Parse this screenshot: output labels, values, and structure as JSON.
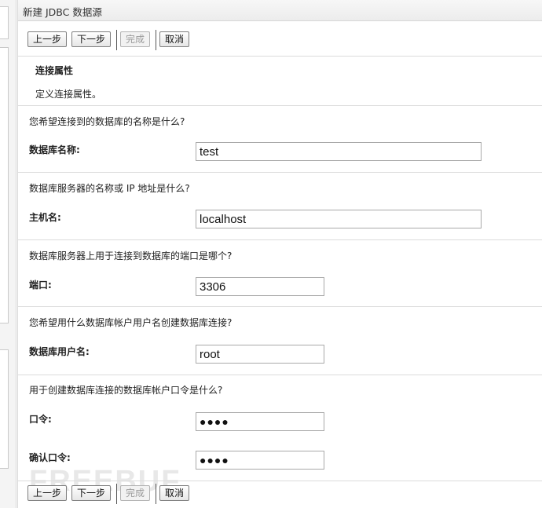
{
  "window": {
    "title": "新建 JDBC 数据源"
  },
  "buttons": {
    "back": "上一步",
    "next": "下一步",
    "finish": "完成",
    "cancel": "取消"
  },
  "section": {
    "title": "连接属性",
    "description": "定义连接属性。"
  },
  "fields": {
    "database_name": {
      "question": "您希望连接到的数据库的名称是什么?",
      "label": "数据库名称:",
      "value": "test"
    },
    "host_name": {
      "question": "数据库服务器的名称或 IP 地址是什么?",
      "label": "主机名:",
      "value": "localhost"
    },
    "port": {
      "question": "数据库服务器上用于连接到数据库的端口是哪个?",
      "label": "端口:",
      "value": "3306"
    },
    "db_user": {
      "question": "您希望用什么数据库帐户用户名创建数据库连接?",
      "label": "数据库用户名:",
      "value": "root"
    },
    "password": {
      "question": "用于创建数据库连接的数据库帐户口令是什么?",
      "label": "口令:",
      "value": "●●●●"
    },
    "confirm_password": {
      "label": "确认口令:",
      "value": "●●●●"
    }
  },
  "watermark": "FREEBUF"
}
